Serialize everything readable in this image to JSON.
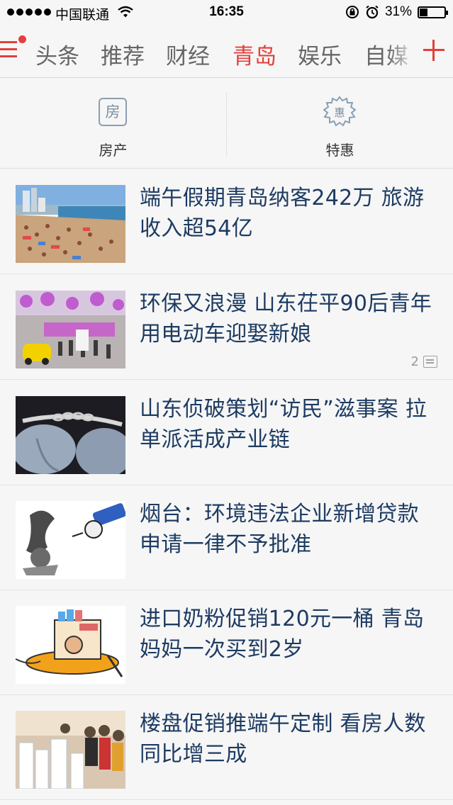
{
  "status_bar": {
    "carrier": "中国联通",
    "time": "16:35",
    "battery_percent_text": "31%",
    "battery_level": 0.31
  },
  "channels": {
    "tabs": [
      {
        "label": "头条",
        "active": false
      },
      {
        "label": "推荐",
        "active": false
      },
      {
        "label": "财经",
        "active": false
      },
      {
        "label": "青岛",
        "active": true
      },
      {
        "label": "娱乐",
        "active": false
      },
      {
        "label": "自媒",
        "active": false
      }
    ],
    "accent_color": "#e2403a"
  },
  "shortcuts": [
    {
      "label": "房产",
      "icon_glyph": "房",
      "icon": "house-icon"
    },
    {
      "label": "特惠",
      "icon_glyph": "惠",
      "icon": "discount-badge-icon"
    }
  ],
  "news": [
    {
      "headline": "端午假期青岛纳客242万 旅游收入超54亿",
      "comments": ""
    },
    {
      "headline": "环保又浪漫 山东茌平90后青年用电动车迎娶新娘",
      "comments": "2"
    },
    {
      "headline": "山东侦破策划“访民”滋事案 拉单派活成产业链",
      "comments": ""
    },
    {
      "headline": "烟台：环境违法企业新增贷款申请一律不予批准",
      "comments": ""
    },
    {
      "headline": "进口奶粉促销120元一桶 青岛妈妈一次买到2岁",
      "comments": ""
    },
    {
      "headline": "楼盘促销推端午定制 看房人数同比增三成",
      "comments": ""
    }
  ]
}
